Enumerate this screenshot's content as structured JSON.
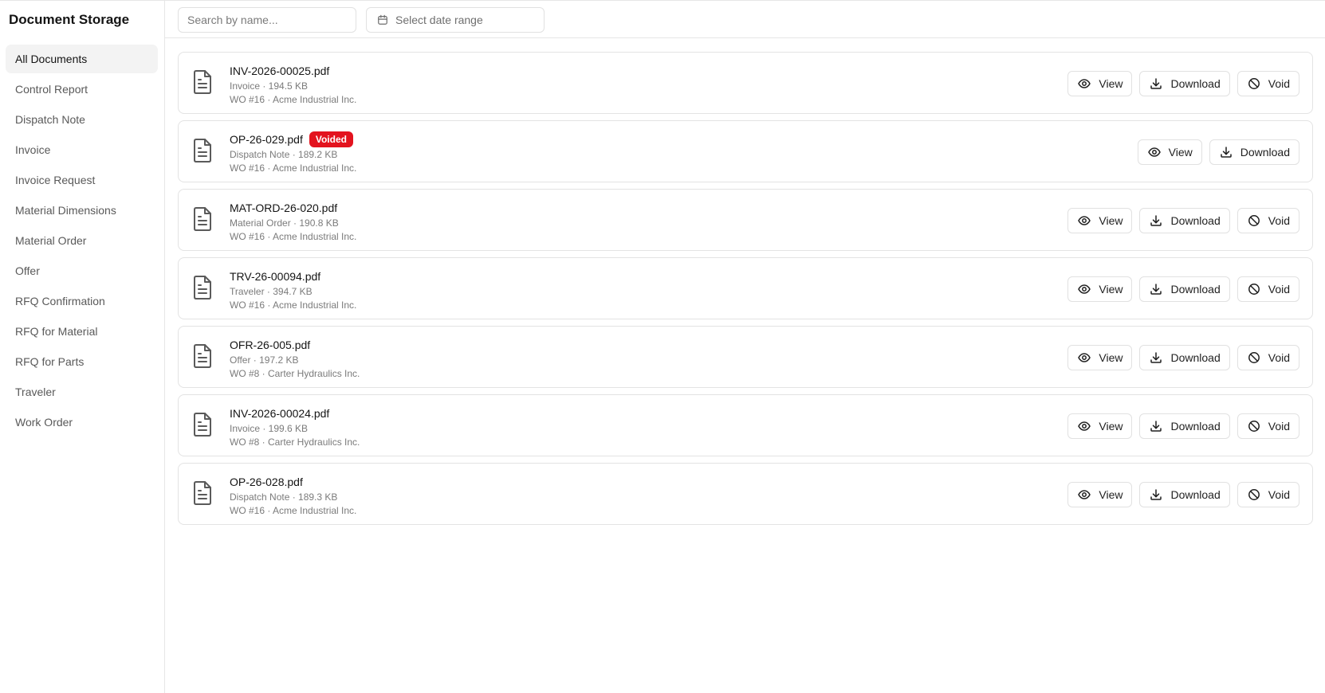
{
  "sidebar": {
    "title": "Document Storage",
    "items": [
      {
        "label": "All Documents",
        "active": true
      },
      {
        "label": "Control Report"
      },
      {
        "label": "Dispatch Note"
      },
      {
        "label": "Invoice"
      },
      {
        "label": "Invoice Request"
      },
      {
        "label": "Material Dimensions"
      },
      {
        "label": "Material Order"
      },
      {
        "label": "Offer"
      },
      {
        "label": "RFQ Confirmation"
      },
      {
        "label": "RFQ for Material"
      },
      {
        "label": "RFQ for Parts"
      },
      {
        "label": "Traveler"
      },
      {
        "label": "Work Order"
      }
    ]
  },
  "toolbar": {
    "search_placeholder": "Search by name...",
    "search_value": "",
    "date_placeholder": "Select date range"
  },
  "actions": {
    "view_label": "View",
    "download_label": "Download",
    "void_label": "Void"
  },
  "documents": [
    {
      "name": "INV-2026-00025.pdf",
      "type_size": "Invoice · 194.5 KB",
      "context": "WO #16 · Acme Industrial Inc.",
      "badge": "",
      "voidable": true
    },
    {
      "name": "OP-26-029.pdf",
      "type_size": "Dispatch Note · 189.2 KB",
      "context": "WO #16 · Acme Industrial Inc.",
      "badge": "Voided",
      "voidable": false
    },
    {
      "name": "MAT-ORD-26-020.pdf",
      "type_size": "Material Order · 190.8 KB",
      "context": "WO #16 · Acme Industrial Inc.",
      "badge": "",
      "voidable": true
    },
    {
      "name": "TRV-26-00094.pdf",
      "type_size": "Traveler · 394.7 KB",
      "context": "WO #16 · Acme Industrial Inc.",
      "badge": "",
      "voidable": true
    },
    {
      "name": "OFR-26-005.pdf",
      "type_size": "Offer · 197.2 KB",
      "context": "WO #8 · Carter Hydraulics Inc.",
      "badge": "",
      "voidable": true
    },
    {
      "name": "INV-2026-00024.pdf",
      "type_size": "Invoice · 199.6 KB",
      "context": "WO #8 · Carter Hydraulics Inc.",
      "badge": "",
      "voidable": true
    },
    {
      "name": "OP-26-028.pdf",
      "type_size": "Dispatch Note · 189.3 KB",
      "context": "WO #16 · Acme Industrial Inc.",
      "badge": "",
      "voidable": true
    }
  ],
  "colors": {
    "voided_badge": "#e3131e",
    "active_nav_bg": "#f3f3f3",
    "border": "#e3e3e3"
  }
}
